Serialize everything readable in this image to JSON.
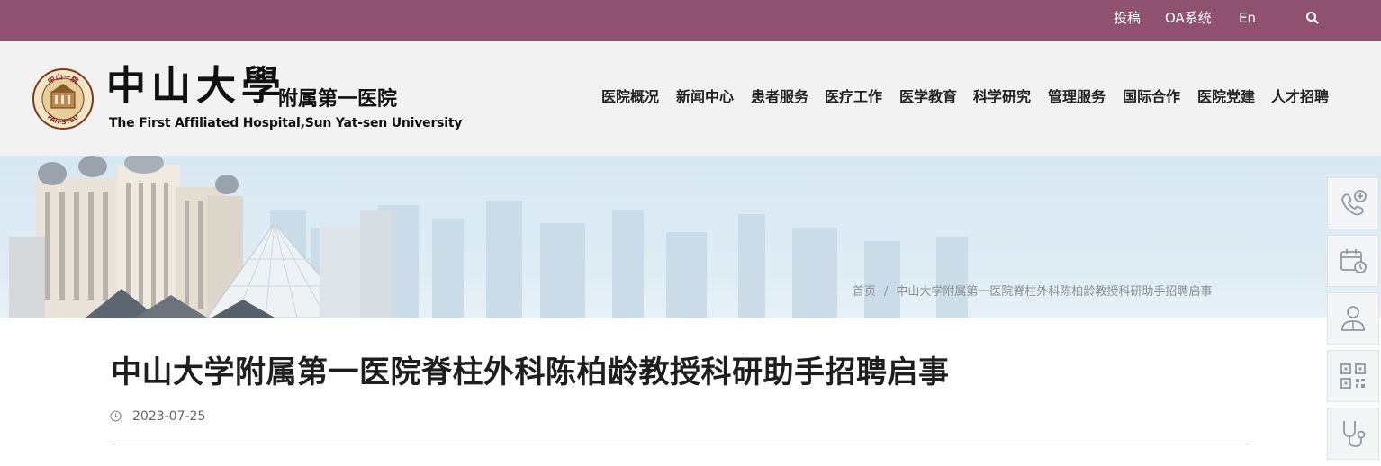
{
  "topbar": {
    "links": [
      "投稿",
      "OA系统",
      "En"
    ],
    "search_icon": "search-icon"
  },
  "header": {
    "logo_cn": "中山大學",
    "logo_sub": "附属第一医院",
    "logo_en": "The First Affiliated Hospital,Sun Yat-sen University",
    "seal_top": "中山一院",
    "seal_bottom": "FAH-SYSU",
    "nav": [
      "医院概况",
      "新闻中心",
      "患者服务",
      "医疗工作",
      "医学教育",
      "科学研究",
      "管理服务",
      "国际合作",
      "医院党建",
      "人才招聘"
    ]
  },
  "breadcrumb": {
    "home": "首页",
    "separator": "/",
    "current": "中山大学附属第一医院脊柱外科陈柏龄教授科研助手招聘启事"
  },
  "article": {
    "title": "中山大学附属第一医院脊柱外科陈柏龄教授科研助手招聘启事",
    "date": "2023-07-25"
  },
  "sidebar": {
    "icons": [
      "phone-plus-icon",
      "calendar-clock-icon",
      "doctor-icon",
      "qr-code-icon",
      "stethoscope-icon"
    ]
  },
  "colors": {
    "topbar": "#8e5170",
    "header_bg": "#f2f2f2",
    "sidebar_icon": "#8f9aa5"
  }
}
